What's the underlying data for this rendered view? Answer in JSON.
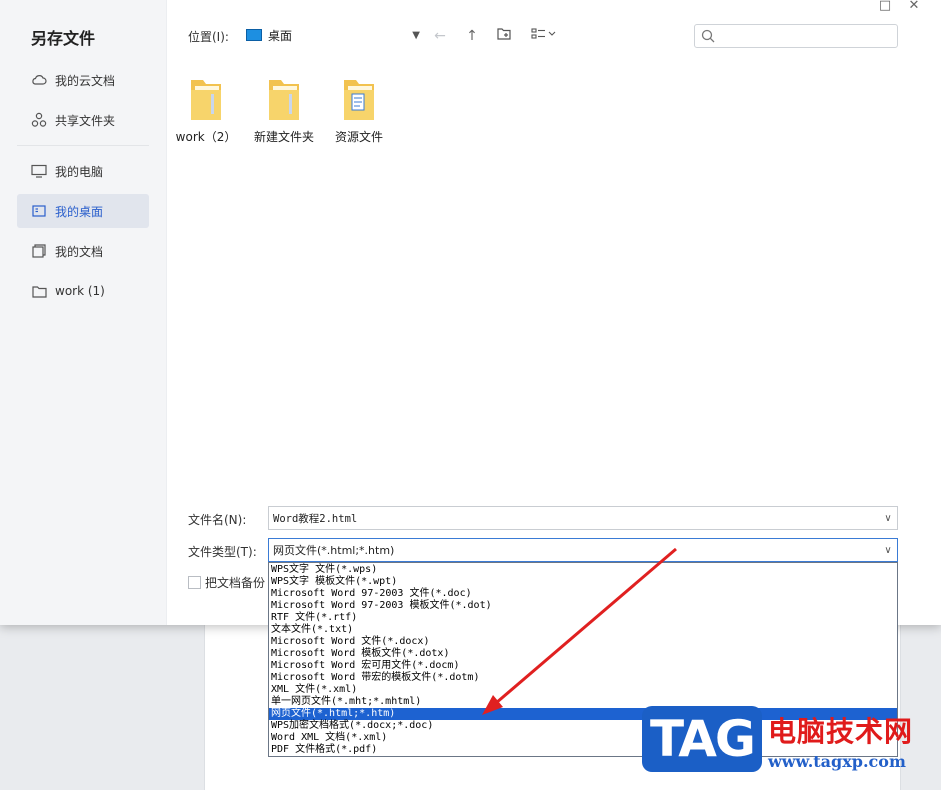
{
  "dialog": {
    "title": "另存文件"
  },
  "sidebar": {
    "items": [
      {
        "label": "我的云文档",
        "icon": "cloud-icon"
      },
      {
        "label": "共享文件夹",
        "icon": "share-icon"
      },
      {
        "label": "我的电脑",
        "icon": "computer-icon"
      },
      {
        "label": "我的桌面",
        "icon": "desktop-icon",
        "active": true
      },
      {
        "label": "我的文档",
        "icon": "document-icon"
      },
      {
        "label": "work (1)",
        "icon": "folder-icon"
      }
    ]
  },
  "toolbar": {
    "location_label": "位置(I):",
    "location_value": "桌面",
    "search_placeholder": ""
  },
  "files": [
    {
      "name": "work（2）",
      "icon": "folder-icon"
    },
    {
      "name": "新建文件夹",
      "icon": "folder-icon"
    },
    {
      "name": "资源文件",
      "icon": "folder-icon"
    }
  ],
  "form": {
    "filename_label": "文件名(N):",
    "filename_value": "Word教程2.html",
    "filetype_label": "文件类型(T):",
    "filetype_value": "网页文件(*.html;*.htm)",
    "backup_label": "把文档备份"
  },
  "filetype_options": [
    "WPS文字 文件(*.wps)",
    "WPS文字 模板文件(*.wpt)",
    "Microsoft Word 97-2003 文件(*.doc)",
    "Microsoft Word 97-2003 模板文件(*.dot)",
    "RTF 文件(*.rtf)",
    "文本文件(*.txt)",
    "Microsoft Word 文件(*.docx)",
    "Microsoft Word 模板文件(*.dotx)",
    "Microsoft Word 宏可用文件(*.docm)",
    "Microsoft Word 带宏的模板文件(*.dotm)",
    "XML 文件(*.xml)",
    "单一网页文件(*.mht;*.mhtml)",
    "网页文件(*.html;*.htm)",
    "WPS加密文档格式(*.docx;*.doc)",
    "Word XML 文档(*.xml)",
    "PDF 文件格式(*.pdf)"
  ],
  "selected_option_index": 12,
  "watermark": {
    "badge": "TAG",
    "title": "电脑技术网",
    "url": "www.tagxp.com"
  },
  "colors": {
    "accent": "#1d62d1",
    "arrow": "#e02020",
    "active_nav_bg": "#e1e5ed",
    "watermark_red": "#e01b1b",
    "watermark_blue": "#1b5fc6"
  }
}
